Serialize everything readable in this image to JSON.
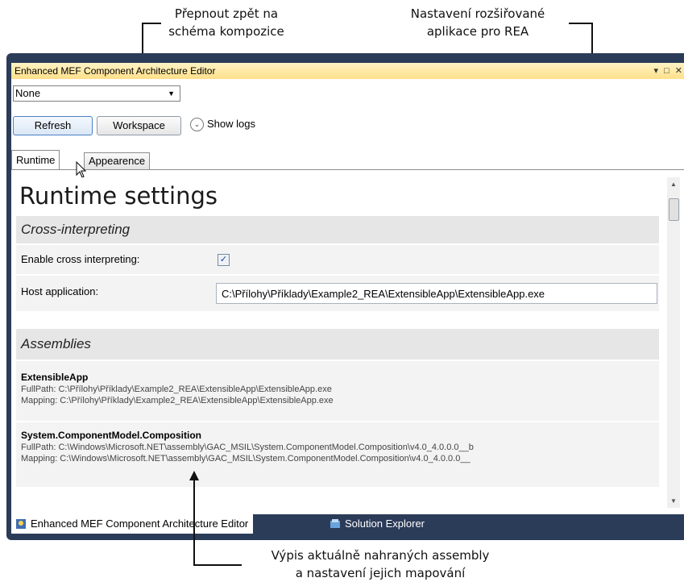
{
  "callouts": {
    "switch_back": [
      "Přepnout zpět na",
      "schéma kompozice"
    ],
    "extensible_settings": [
      "Nastavení rozšiřované",
      "aplikace pro REA"
    ],
    "loaded_assemblies": [
      "Výpis aktuálně nahraných assembly",
      "a nastavení jejich mapování"
    ]
  },
  "window": {
    "title": "Enhanced MEF Component Architecture Editor",
    "controls": [
      "▾",
      "□",
      "✕"
    ]
  },
  "toolbar": {
    "dropdown_value": "None",
    "refresh_label": "Refresh",
    "workspace_label": "Workspace",
    "show_logs_label": "Show logs"
  },
  "tabs": [
    {
      "label": "Runtime",
      "active": true
    },
    {
      "label": "Appearence",
      "active": false
    }
  ],
  "runtime": {
    "title": "Runtime settings",
    "cross_section": "Cross-interpreting",
    "enable_label": "Enable cross interpreting:",
    "enable_checked": true,
    "host_label": "Host application:",
    "host_value": "C:\\Přílohy\\Příklady\\Example2_REA\\ExtensibleApp\\ExtensibleApp.exe",
    "assemblies_section": "Assemblies",
    "assemblies": [
      {
        "name": "ExtensibleApp",
        "full_path": "FullPath: C:\\Přílohy\\Příklady\\Example2_REA\\ExtensibleApp\\ExtensibleApp.exe",
        "mapping": "Mapping: C:\\Přílohy\\Příklady\\Example2_REA\\ExtensibleApp\\ExtensibleApp.exe"
      },
      {
        "name": "System.ComponentModel.Composition",
        "full_path": "FullPath: C:\\Windows\\Microsoft.NET\\assembly\\GAC_MSIL\\System.ComponentModel.Composition\\v4.0_4.0.0.0__b",
        "mapping": "Mapping: C:\\Windows\\Microsoft.NET\\assembly\\GAC_MSIL\\System.ComponentModel.Composition\\v4.0_4.0.0.0__"
      }
    ]
  },
  "bottom_tabs": [
    {
      "label": "Enhanced MEF Component Architecture Editor",
      "icon": "component-icon"
    },
    {
      "label": "Solution Explorer",
      "icon": "solution-explorer-icon"
    }
  ],
  "colors": {
    "frame": "#2b3c59",
    "titlebar": "#ffe08a",
    "section": "#e6e6e6",
    "row": "#f3f3f3"
  }
}
